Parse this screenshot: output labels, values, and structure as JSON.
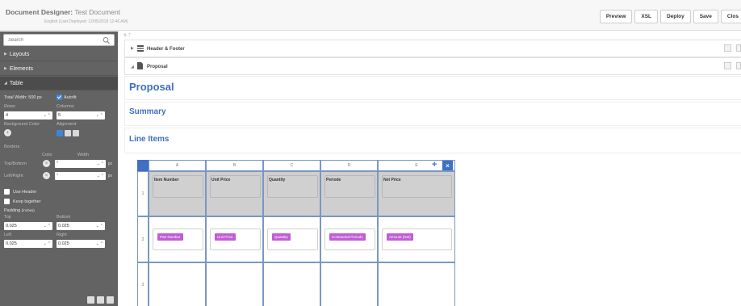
{
  "header": {
    "title_label": "Document Designer:",
    "title_name": "Test Document",
    "subtitle": "English (Last Deployed: 12/05/2018 12:46 AM)"
  },
  "toolbar": {
    "preview": "Preview",
    "xsl": "XSL",
    "deploy": "Deploy",
    "save": "Save",
    "close": "Clos"
  },
  "sidebar": {
    "search_placeholder": "Search",
    "sections": {
      "layouts": "Layouts",
      "elements": "Elements",
      "table": "Table"
    },
    "table_props": {
      "total_width": "Total Width: 500 px",
      "autofit": "Autofit",
      "rows_label": "Rows",
      "rows_value": "4",
      "columns_label": "Columns",
      "columns_value": "5",
      "bg_color_label": "Background Color",
      "alignment_label": "Alignment",
      "borders_label": "Borders",
      "color_label": "Color",
      "width_label": "Width",
      "top_bottom_label": "Top/Bottom",
      "left_right_label": "Left/Right",
      "px_unit": "px",
      "use_header": "Use Header",
      "keep_together": "Keep together",
      "padding_label": "Padding",
      "padding_unit": "(inches)",
      "top_label": "Top",
      "bottom_label": "Bottom",
      "left_label": "Left",
      "right_label": "Right",
      "padding_top": "0.025",
      "padding_bottom": "0.025",
      "padding_left": "0.025",
      "padding_right": "0.025"
    }
  },
  "canvas": {
    "header_footer": "Header & Footer",
    "proposal_section": "Proposal",
    "heading_proposal": "Proposal",
    "heading_summary": "Summary",
    "heading_line_items": "Line Items"
  },
  "table": {
    "columns": [
      "A",
      "B",
      "C",
      "D",
      "E"
    ],
    "rows": [
      "1",
      "2",
      "3"
    ],
    "header_cells": [
      "Item Number",
      "Unit Price",
      "Quantity",
      "Periode",
      "Net Price"
    ],
    "field_chips": [
      "Part Number",
      "Unit Price",
      "Quantity",
      "Contracted Periods",
      "Amount (Net)"
    ]
  },
  "colors": {
    "accent": "#3f6fc6",
    "chip": "#c25cd6",
    "panel": "#636363"
  }
}
